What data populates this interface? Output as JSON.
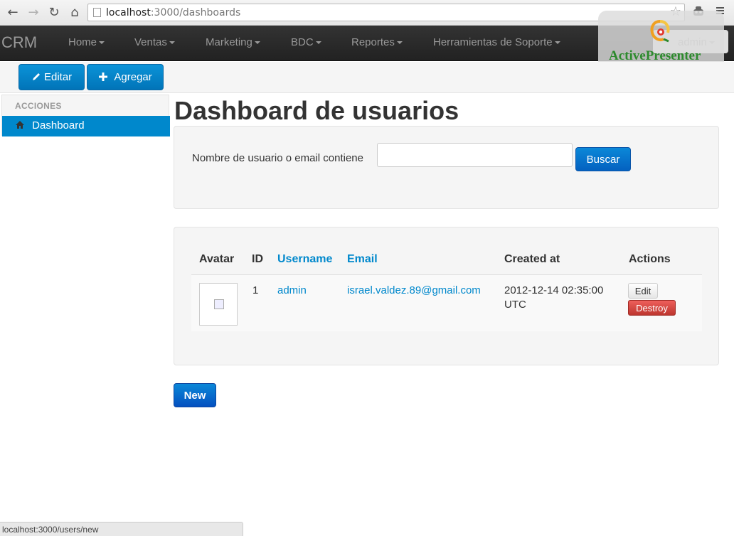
{
  "browser": {
    "url_host": "localhost",
    "url_rest": ":3000/dashboards",
    "back_icon": "←",
    "forward_icon": "→",
    "reload_icon": "↻",
    "home_icon": "⌂",
    "star_icon": "☆",
    "status_url": "localhost:3000/users/new"
  },
  "navbar": {
    "brand": "CRM",
    "items": [
      {
        "label": "Home"
      },
      {
        "label": "Ventas"
      },
      {
        "label": "Marketing"
      },
      {
        "label": "BDC"
      },
      {
        "label": "Reportes"
      },
      {
        "label": "Herramientas de Soporte"
      }
    ],
    "user": "admin"
  },
  "watermark": {
    "text": "ActivePresenter"
  },
  "toolbar": {
    "edit_label": "Editar",
    "add_label": "Agregar"
  },
  "sidebar": {
    "header": "ACCIONES",
    "items": [
      {
        "label": "Dashboard",
        "active": true
      }
    ]
  },
  "main": {
    "title": "Dashboard de usuarios",
    "search": {
      "label": "Nombre de usuario o email contiene",
      "value": "",
      "button": "Buscar"
    },
    "table": {
      "headers": [
        "Avatar",
        "ID",
        "Username",
        "Email",
        "Created at",
        "Actions"
      ],
      "rows": [
        {
          "id": "1",
          "username": "admin",
          "email": "israel.valdez.89@gmail.com",
          "created_at_line1": "2012-12-14 02:35:00",
          "created_at_line2": "UTC",
          "edit": "Edit",
          "destroy": "Destroy"
        }
      ]
    },
    "new_button": "New"
  },
  "colors": {
    "primary": "#0088cc",
    "danger": "#bd362f",
    "navbar": "#222222",
    "watermark_text": "#2d8a2d"
  }
}
